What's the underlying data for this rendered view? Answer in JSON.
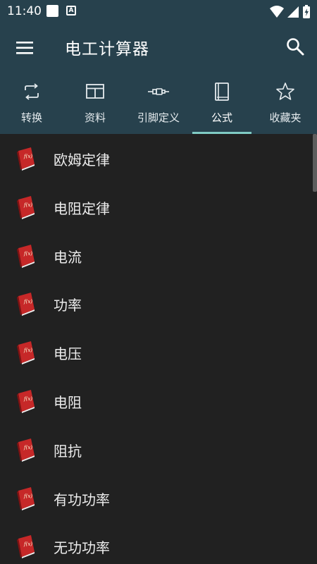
{
  "status_bar": {
    "time": "11:40",
    "a_icon_letter": "A"
  },
  "app_bar": {
    "title": "电工计算器",
    "menu_icon": "menu-icon",
    "search_icon": "search-icon"
  },
  "tabs": [
    {
      "label": "转换",
      "icon": "convert-icon",
      "active": false
    },
    {
      "label": "资料",
      "icon": "table-icon",
      "active": false
    },
    {
      "label": "引脚定义",
      "icon": "connector-icon",
      "active": false
    },
    {
      "label": "公式",
      "icon": "book-icon",
      "active": true
    },
    {
      "label": "收藏夹",
      "icon": "star-icon",
      "active": false
    }
  ],
  "list": {
    "items": [
      {
        "label": "欧姆定律"
      },
      {
        "label": "电阻定律"
      },
      {
        "label": "电流"
      },
      {
        "label": "功率"
      },
      {
        "label": "电压"
      },
      {
        "label": "电阻"
      },
      {
        "label": "阻抗"
      },
      {
        "label": "有功功率"
      },
      {
        "label": "无功功率"
      }
    ],
    "item_icon": "formula-book-icon"
  },
  "colors": {
    "primary": "#27414d",
    "background": "#212121",
    "indicator": "#80cbc4",
    "book_red": "#c62828"
  }
}
